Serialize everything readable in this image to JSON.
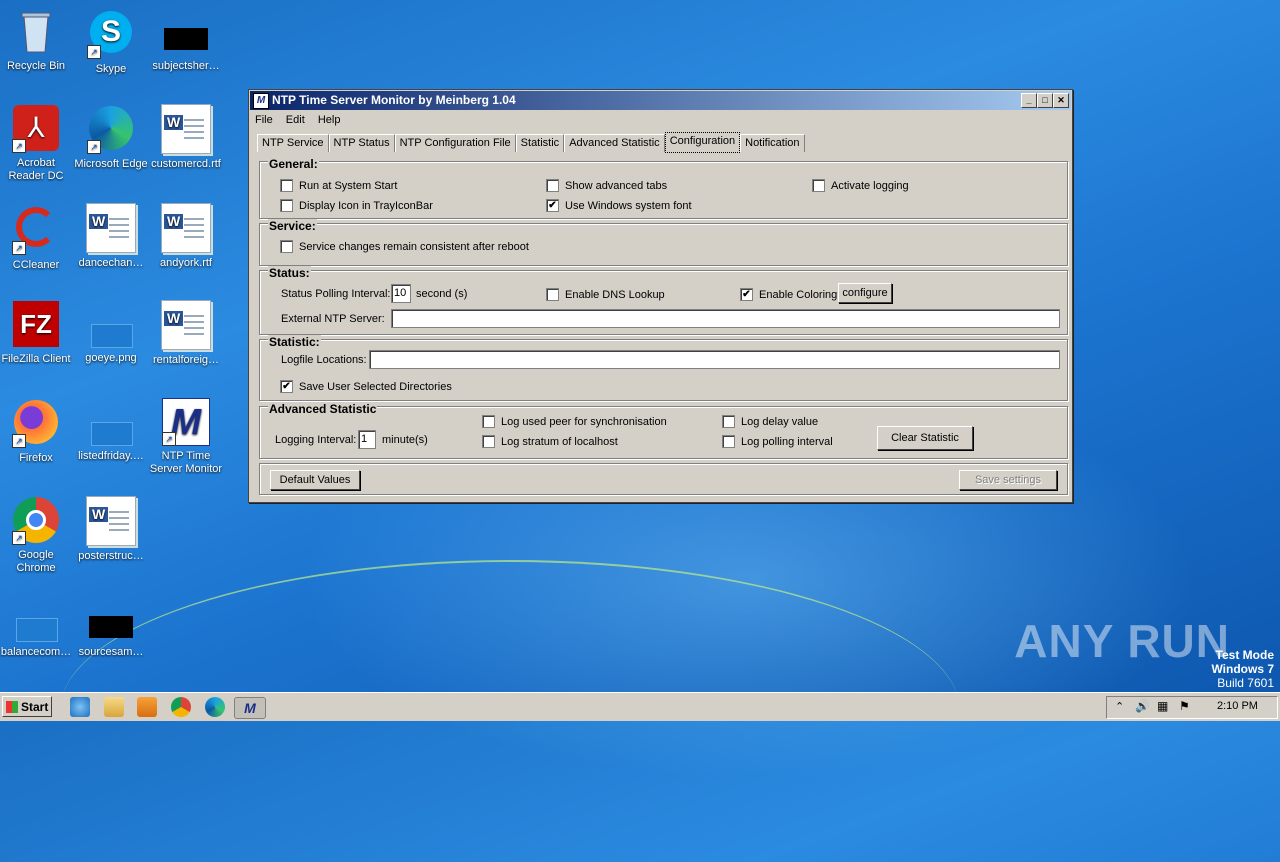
{
  "desktop": {
    "icons": [
      {
        "label": "Recycle Bin",
        "icon": "recycle-bin-icon"
      },
      {
        "label": "Skype",
        "icon": "skype-icon"
      },
      {
        "label": "subjectsher…",
        "icon": "file-icon"
      },
      {
        "label": "Acrobat Reader DC",
        "icon": "acrobat-icon"
      },
      {
        "label": "Microsoft Edge",
        "icon": "edge-icon"
      },
      {
        "label": "customercd.rtf",
        "icon": "word-doc-icon"
      },
      {
        "label": "CCleaner",
        "icon": "ccleaner-icon"
      },
      {
        "label": "dancechan…",
        "icon": "word-doc-icon"
      },
      {
        "label": "andyork.rtf",
        "icon": "word-doc-icon"
      },
      {
        "label": "FileZilla Client",
        "icon": "filezilla-icon"
      },
      {
        "label": "goeye.png",
        "icon": "image-icon"
      },
      {
        "label": "rentalforeig…",
        "icon": "word-doc-icon"
      },
      {
        "label": "Firefox",
        "icon": "firefox-icon"
      },
      {
        "label": "listedfriday.…",
        "icon": "file-icon"
      },
      {
        "label": "NTP Time Server Monitor",
        "icon": "ntp-icon"
      },
      {
        "label": "Google Chrome",
        "icon": "chrome-icon"
      },
      {
        "label": "posterstruc…",
        "icon": "word-doc-icon"
      },
      {
        "label": "balancecom…",
        "icon": "file-icon"
      },
      {
        "label": "sourcesam…",
        "icon": "file-icon"
      }
    ]
  },
  "window": {
    "title": "NTP Time Server Monitor by Meinberg 1.04",
    "menu": [
      "File",
      "Edit",
      "Help"
    ],
    "tabs": [
      "NTP Service",
      "NTP Status",
      "NTP Configuration File",
      "Statistic",
      "Advanced Statistic",
      "Configuration",
      "Notification"
    ],
    "active_tab": "Configuration",
    "general": {
      "title": "General:",
      "run_at_start": {
        "label": "Run at System Start",
        "checked": false
      },
      "display_icon": {
        "label": "Display Icon in TrayIconBar",
        "checked": false
      },
      "show_advanced_tabs": {
        "label": "Show advanced tabs",
        "checked": false
      },
      "use_windows_font": {
        "label": "Use Windows system font",
        "checked": true
      },
      "activate_logging": {
        "label": "Activate logging",
        "checked": false
      }
    },
    "service": {
      "title": "Service:",
      "consistent": {
        "label": "Service changes remain consistent after reboot",
        "checked": false
      }
    },
    "status": {
      "title": "Status:",
      "polling_label": "Status Polling Interval:",
      "polling_value": "10",
      "polling_unit": "second (s)",
      "dns_lookup": {
        "label": "Enable DNS Lookup",
        "checked": false
      },
      "coloring": {
        "label": "Enable Coloring",
        "checked": true
      },
      "configure_button": "configure",
      "external_label": "External NTP Server:",
      "external_value": ""
    },
    "statistic": {
      "title": "Statistic:",
      "logfile_label": "Logfile Locations:",
      "logfile_value": "",
      "save_dirs": {
        "label": "Save User Selected Directories",
        "checked": true
      }
    },
    "advanced": {
      "title": "Advanced Statistic",
      "interval_label": "Logging Interval:",
      "interval_value": "1",
      "interval_unit": "minute(s)",
      "log_peer": {
        "label": "Log used peer for synchronisation",
        "checked": false
      },
      "log_stratum": {
        "label": "Log stratum of localhost",
        "checked": false
      },
      "log_delay": {
        "label": "Log delay value",
        "checked": false
      },
      "log_polling": {
        "label": "Log polling interval",
        "checked": false
      },
      "clear_button": "Clear Statistic"
    },
    "default_button": "Default Values",
    "save_button": "Save settings",
    "check_mark": "✔"
  },
  "taskbar": {
    "start_label": "Start",
    "clock": "2:10 PM"
  },
  "watermark": "ANY RUN",
  "test_mode": {
    "line1": "Test Mode",
    "line2": "Windows 7",
    "line3": "Build 7601"
  }
}
